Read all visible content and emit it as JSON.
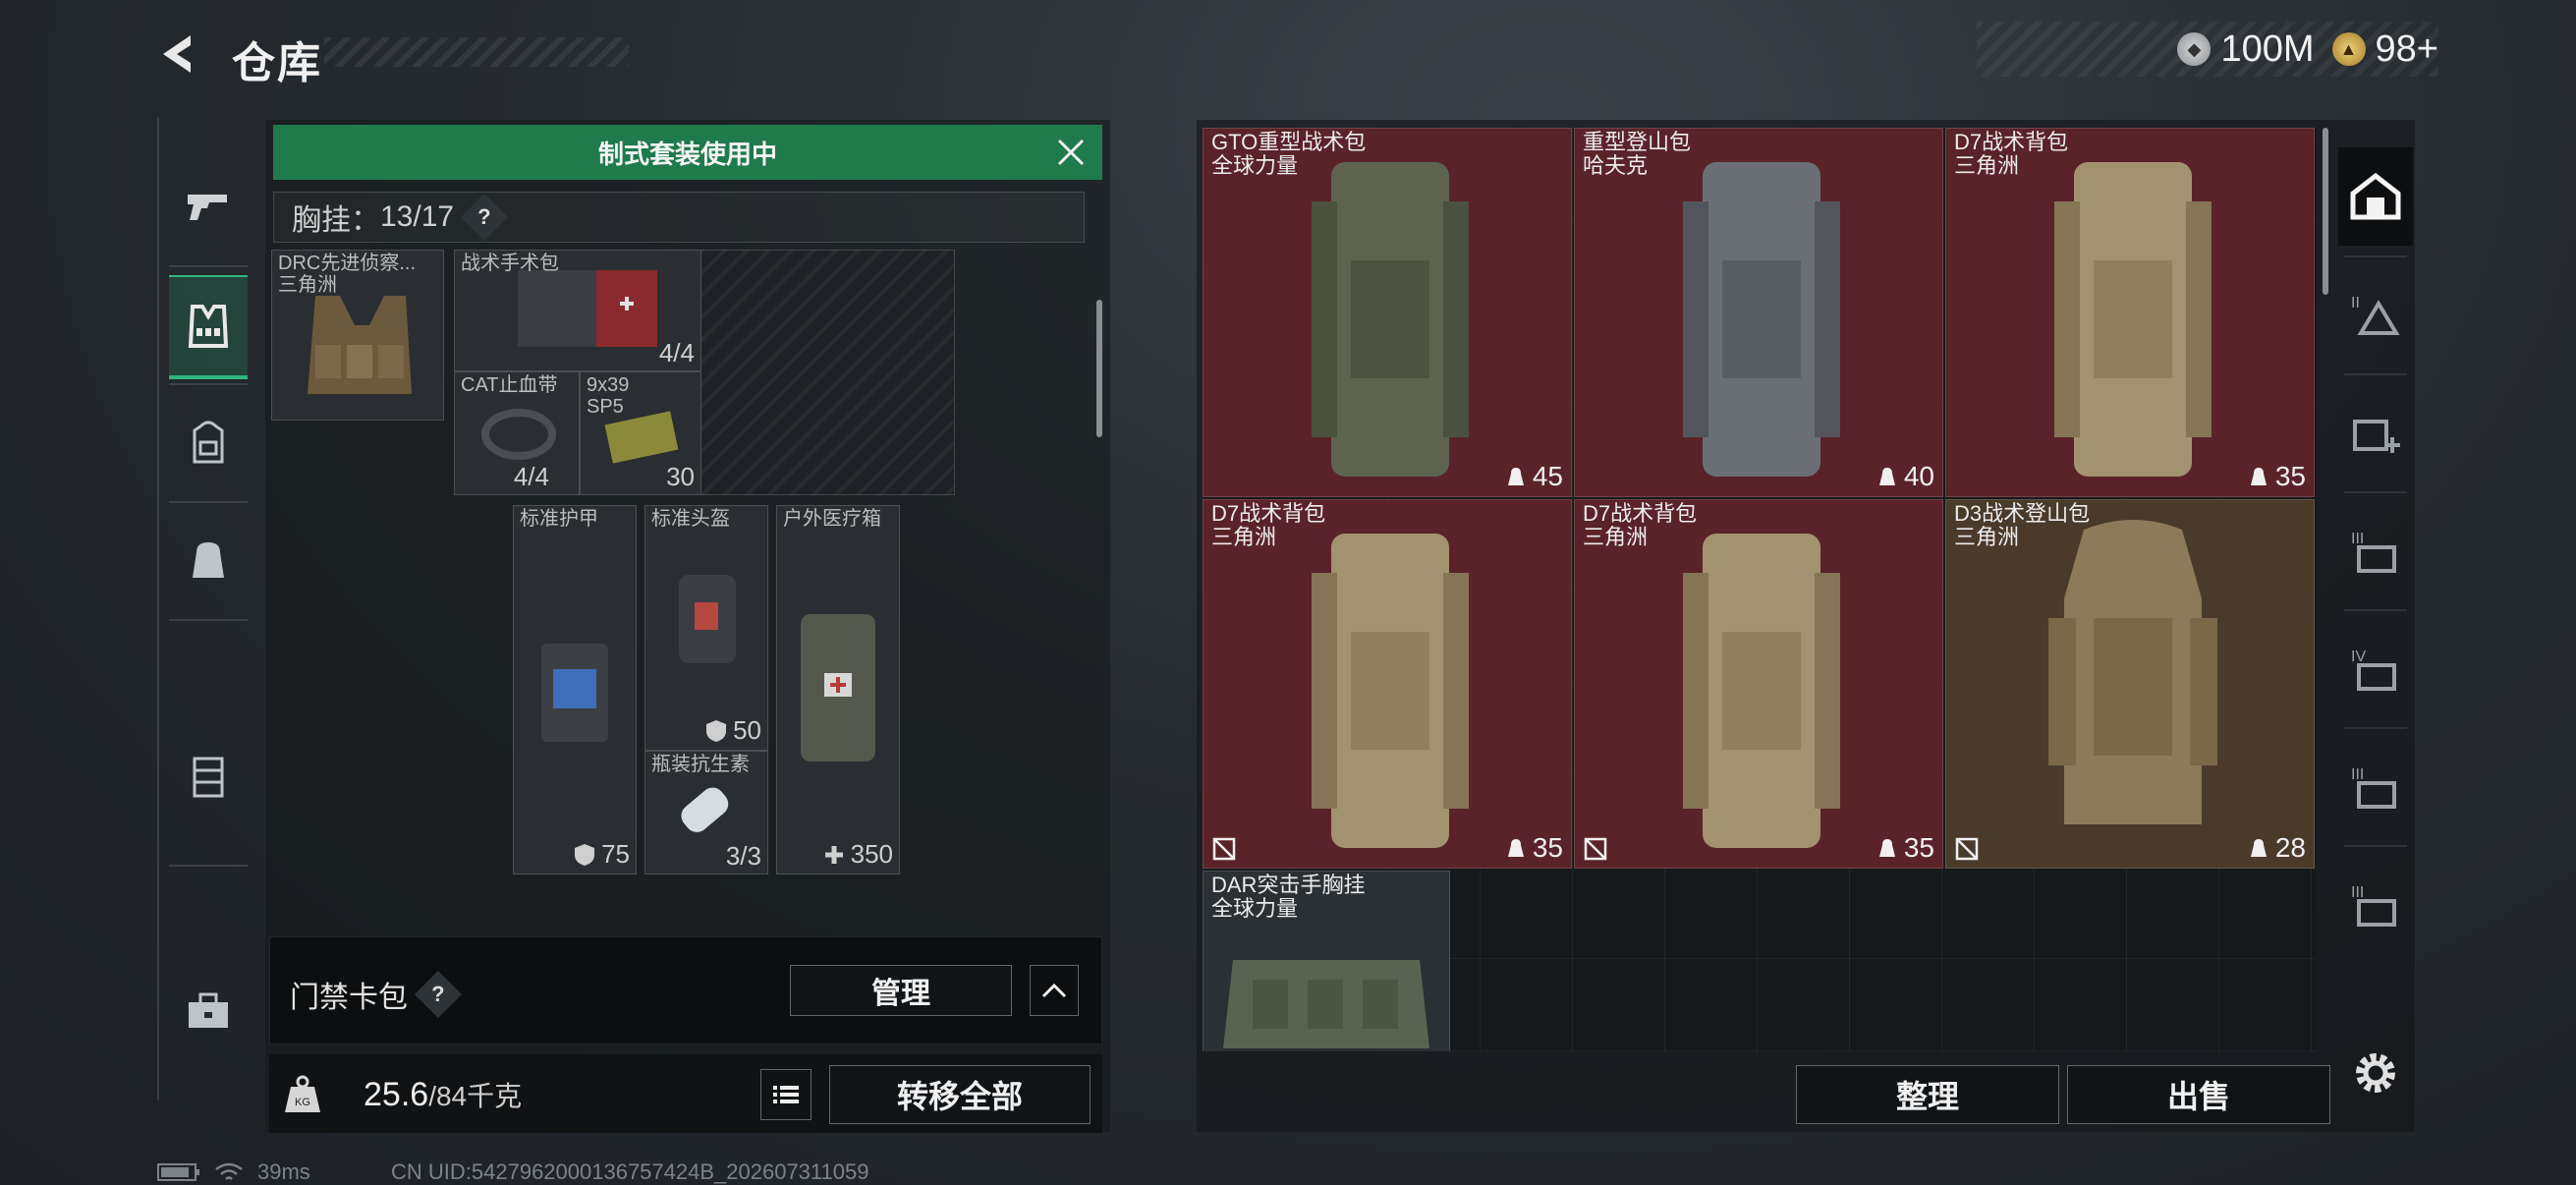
{
  "header": {
    "title": "仓库",
    "back_icon": "back-arrow-icon"
  },
  "currency": {
    "silver": "100M",
    "gold": "98+"
  },
  "left_nav": {
    "items": [
      "gun-icon",
      "vest-icon",
      "backpack-icon",
      "bag-icon",
      "container-icon",
      "toolbox-icon"
    ],
    "active": "vest-icon"
  },
  "loadout": {
    "banner": "制式套装使用中",
    "rig_label": "胸挂：",
    "rig_capacity": "13/17",
    "help": "?",
    "rig_item": {
      "name": "DRC先进侦察...",
      "sub": "三角洲"
    },
    "slots": [
      {
        "name": "战术手术包",
        "qty": "4/4"
      },
      {
        "name": "CAT止血带",
        "qty": "4/4"
      },
      {
        "name": "9x39",
        "sub": "SP5",
        "qty": "30"
      },
      {
        "name": "标准护甲",
        "stat": "75"
      },
      {
        "name": "标准头盔",
        "stat": "50"
      },
      {
        "name": "瓶装抗生素",
        "qty": "3/3"
      },
      {
        "name": "户外医疗箱",
        "stat": "350"
      }
    ]
  },
  "keycard": {
    "label": "门禁卡包",
    "help": "?",
    "manage": "管理"
  },
  "weight": {
    "current": "25.6",
    "capacity": "/84千克"
  },
  "transfer_all": "转移全部",
  "stash": {
    "items": [
      {
        "name": "GTO重型战术包",
        "sub": "全球力量",
        "capacity": "45",
        "locked": false,
        "color": "red"
      },
      {
        "name": "重型登山包",
        "sub": "哈夫克",
        "capacity": "40",
        "locked": false,
        "color": "red"
      },
      {
        "name": "D7战术背包",
        "sub": "三角洲",
        "capacity": "35",
        "locked": false,
        "color": "red"
      },
      {
        "name": "D7战术背包",
        "sub": "三角洲",
        "capacity": "35",
        "locked": true,
        "color": "red"
      },
      {
        "name": "D7战术背包",
        "sub": "三角洲",
        "capacity": "35",
        "locked": true,
        "color": "red"
      },
      {
        "name": "D3战术登山包",
        "sub": "三角洲",
        "capacity": "28",
        "locked": true,
        "color": "brown"
      },
      {
        "name": "DAR突击手胸挂",
        "sub": "全球力量",
        "capacity": "",
        "locked": false,
        "color": "grey"
      }
    ],
    "sort": "整理",
    "sell": "出售"
  },
  "right_nav": {
    "items": [
      "storage-icon",
      "tier-II-icon",
      "add-storage-icon",
      "tier-III-icon",
      "tier-IV-icon",
      "tier-III-b-icon",
      "tier-III-c-icon"
    ],
    "tiers": [
      "II",
      "III",
      "IV",
      "III",
      "III"
    ]
  },
  "status": {
    "ping": "39ms",
    "uid": "CN UID:5427962000136757424B_202607311059"
  },
  "colors": {
    "accent": "#1f7a4c",
    "red_slot": "#5a2329",
    "brown_slot": "#4a3a2a"
  }
}
